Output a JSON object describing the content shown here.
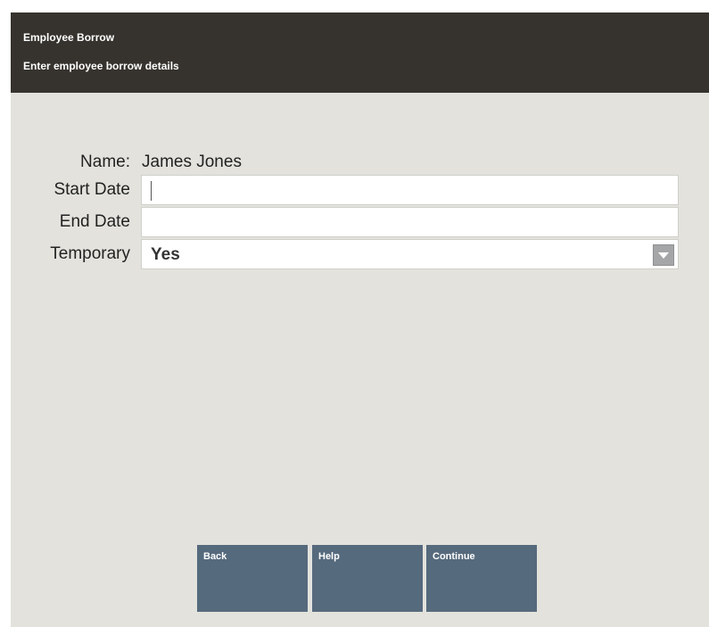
{
  "header": {
    "title": "Employee Borrow",
    "subtitle": "Enter employee borrow details"
  },
  "form": {
    "name_label": "Name:",
    "name_value": "James Jones",
    "start_date_label": "Start Date",
    "start_date_value": "",
    "end_date_label": "End Date",
    "end_date_value": "",
    "temporary_label": "Temporary",
    "temporary_value": "Yes"
  },
  "buttons": {
    "back": "Back",
    "help": "Help",
    "continue": "Continue"
  },
  "colors": {
    "header_bg": "#36332e",
    "panel_bg": "#e3e2dd",
    "button_bg": "#566a7d"
  },
  "icons": {
    "dropdown": "chevron-down-icon"
  }
}
